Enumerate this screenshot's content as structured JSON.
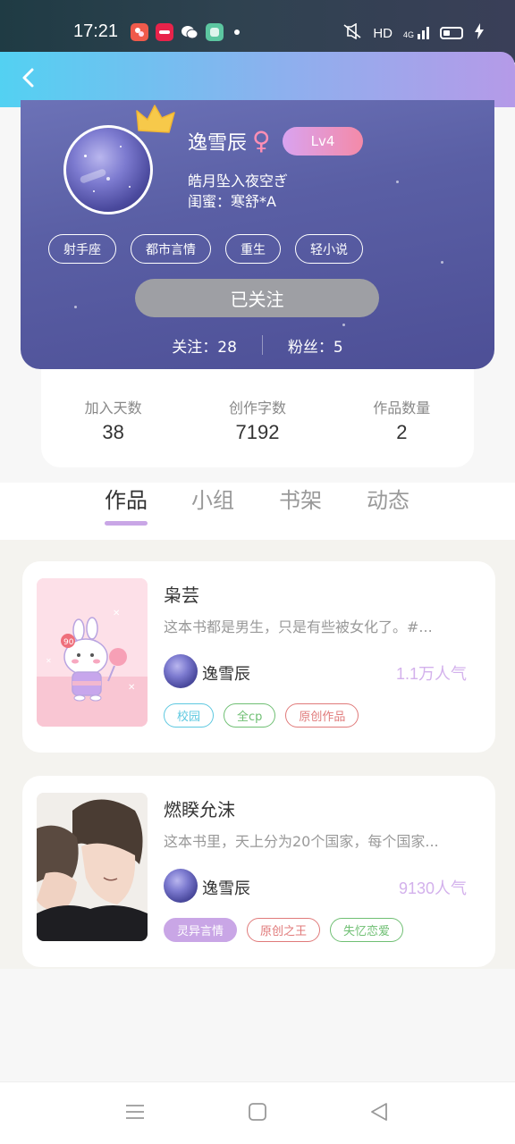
{
  "status_bar": {
    "time": "17:21",
    "network": "HD",
    "signal": "4G",
    "apps": [
      {
        "icon": "shopping-app-icon",
        "color": "#f05a4b"
      },
      {
        "icon": "taobao-app-icon",
        "color": "#e8234a"
      },
      {
        "icon": "wechat-icon",
        "color": "#ffffff"
      },
      {
        "icon": "message-app-icon",
        "color": "#5cc6a0"
      }
    ]
  },
  "header": {
    "back_icon": "chevron-left-icon"
  },
  "profile": {
    "nickname": "逸雪辰",
    "gender_symbol": "♀",
    "level": "Lv4",
    "signature": "皓月坠入夜空ぎ",
    "bestie": "闺蜜：寒舒*A",
    "tags": [
      "射手座",
      "都市言情",
      "重生",
      "轻小说"
    ],
    "follow_label": "已关注",
    "following": "关注：28",
    "fans": "粉丝：5",
    "colors": {
      "card_top": "#6c72b7",
      "card_bottom": "#4d4f96",
      "level_start": "#d9a3f0",
      "level_end": "#f48aa8",
      "crown": "#f7c94a"
    }
  },
  "stats": [
    {
      "label": "加入天数",
      "value": "38"
    },
    {
      "label": "创作字数",
      "value": "7192"
    },
    {
      "label": "作品数量",
      "value": "2"
    }
  ],
  "tabs": [
    {
      "label": "作品",
      "active": true
    },
    {
      "label": "小组",
      "active": false
    },
    {
      "label": "书架",
      "active": false
    },
    {
      "label": "动态",
      "active": false
    }
  ],
  "works": [
    {
      "title": "枭芸",
      "desc": "这本书都是男生，只是有些被女化了。#...",
      "author": "逸雪辰",
      "popularity": "1.1万人气",
      "tags": [
        {
          "label": "校园",
          "color": "#5dc8e0"
        },
        {
          "label": "全cp",
          "color": "#6fbf73"
        },
        {
          "label": "原创作品",
          "color": "#e07a7a"
        }
      ]
    },
    {
      "title": "燃睽允沫",
      "desc": "这本书里，天上分为20个国家，每个国家...",
      "author": "逸雪辰",
      "popularity": "9130人气",
      "tags": [
        {
          "label": "灵异言情",
          "color": "#c9a6e6",
          "filled": true
        },
        {
          "label": "原创之王",
          "color": "#e07a7a"
        },
        {
          "label": "失忆恋爱",
          "color": "#6fbf73"
        }
      ]
    }
  ],
  "nav": {
    "menu_icon": "menu-icon",
    "home_icon": "home-square-icon",
    "back_icon": "back-triangle-icon"
  }
}
